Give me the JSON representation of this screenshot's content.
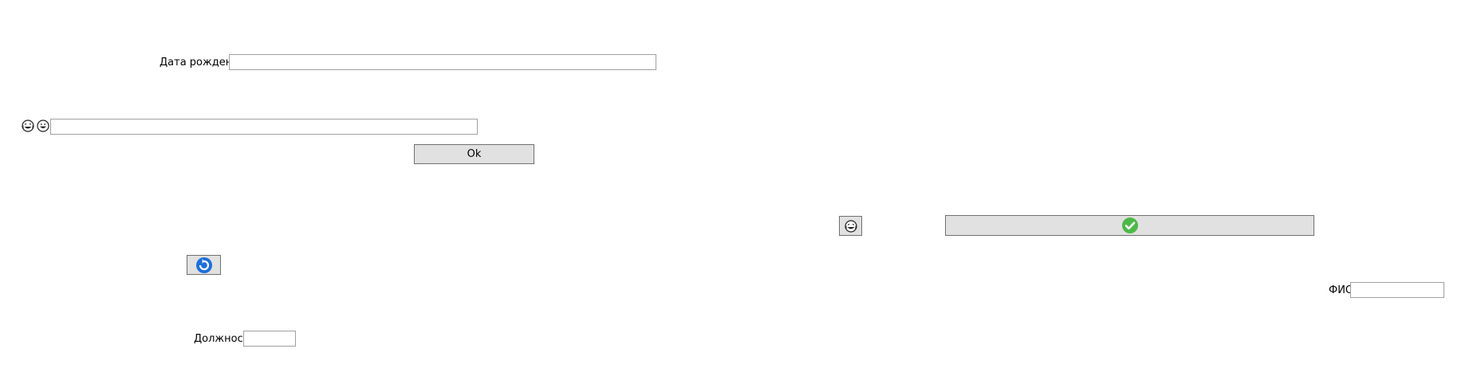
{
  "form": {
    "birth_date": {
      "label": "Дата рождения",
      "value": "",
      "placeholder": ""
    },
    "emoji_row": {
      "icons": [
        "laughing-tears-emoji-icon",
        "grinning-emoji-icon"
      ],
      "value": "",
      "placeholder": ""
    },
    "ok_button": {
      "label": "Ok"
    },
    "refresh_button": {
      "icon": "refresh-icon",
      "icon_color": "#1e6fd9"
    },
    "position": {
      "label": "Должность",
      "value": "",
      "placeholder": ""
    },
    "emoji_button": {
      "icon": "laughing-tears-emoji-icon"
    },
    "confirm_button": {
      "icon": "green-checkmark-icon",
      "icon_color": "#4cb847"
    },
    "full_name": {
      "label": "ФИО",
      "value": "",
      "placeholder": ""
    }
  },
  "colors": {
    "background": "#ffffff",
    "button_face": "#e1e1e1",
    "button_border": "#707070",
    "input_border": "#a0a0a0"
  }
}
